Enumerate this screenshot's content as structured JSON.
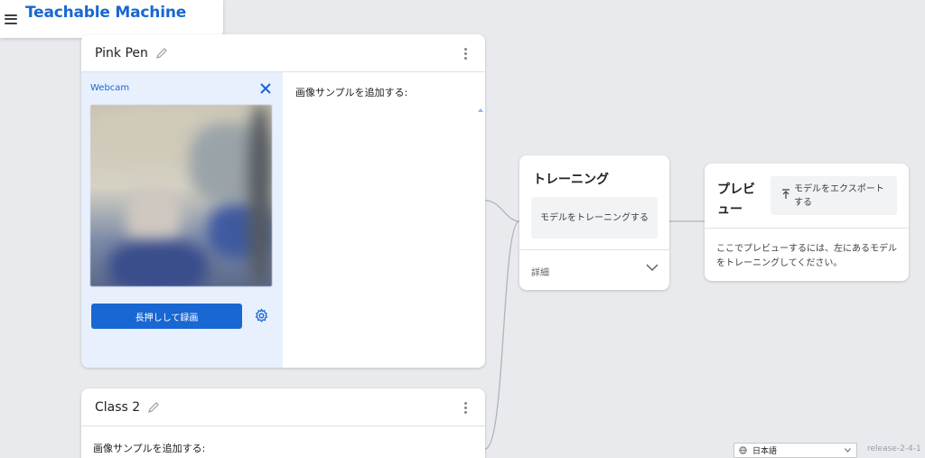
{
  "app": {
    "brand": "Teachable Machine"
  },
  "class1": {
    "title": "Pink Pen",
    "webcam_label": "Webcam",
    "record_label": "長押しして録画",
    "samples_label": "画像サンプルを追加する:"
  },
  "class2": {
    "title": "Class 2",
    "samples_label": "画像サンプルを追加する:"
  },
  "training": {
    "title": "トレーニング",
    "train_button": "モデルをトレーニングする",
    "details_label": "詳細"
  },
  "preview": {
    "title": "プレビュー",
    "export_button": "モデルをエクスポートする",
    "message": "ここでプレビューするには、左にあるモデルをトレーニングしてください。"
  },
  "footer": {
    "language": "日本語",
    "release": "release-2-4-1"
  },
  "colors": {
    "accent": "#1967d2",
    "webcam_panel": "#e8f0fe",
    "background": "#e8eaed"
  }
}
